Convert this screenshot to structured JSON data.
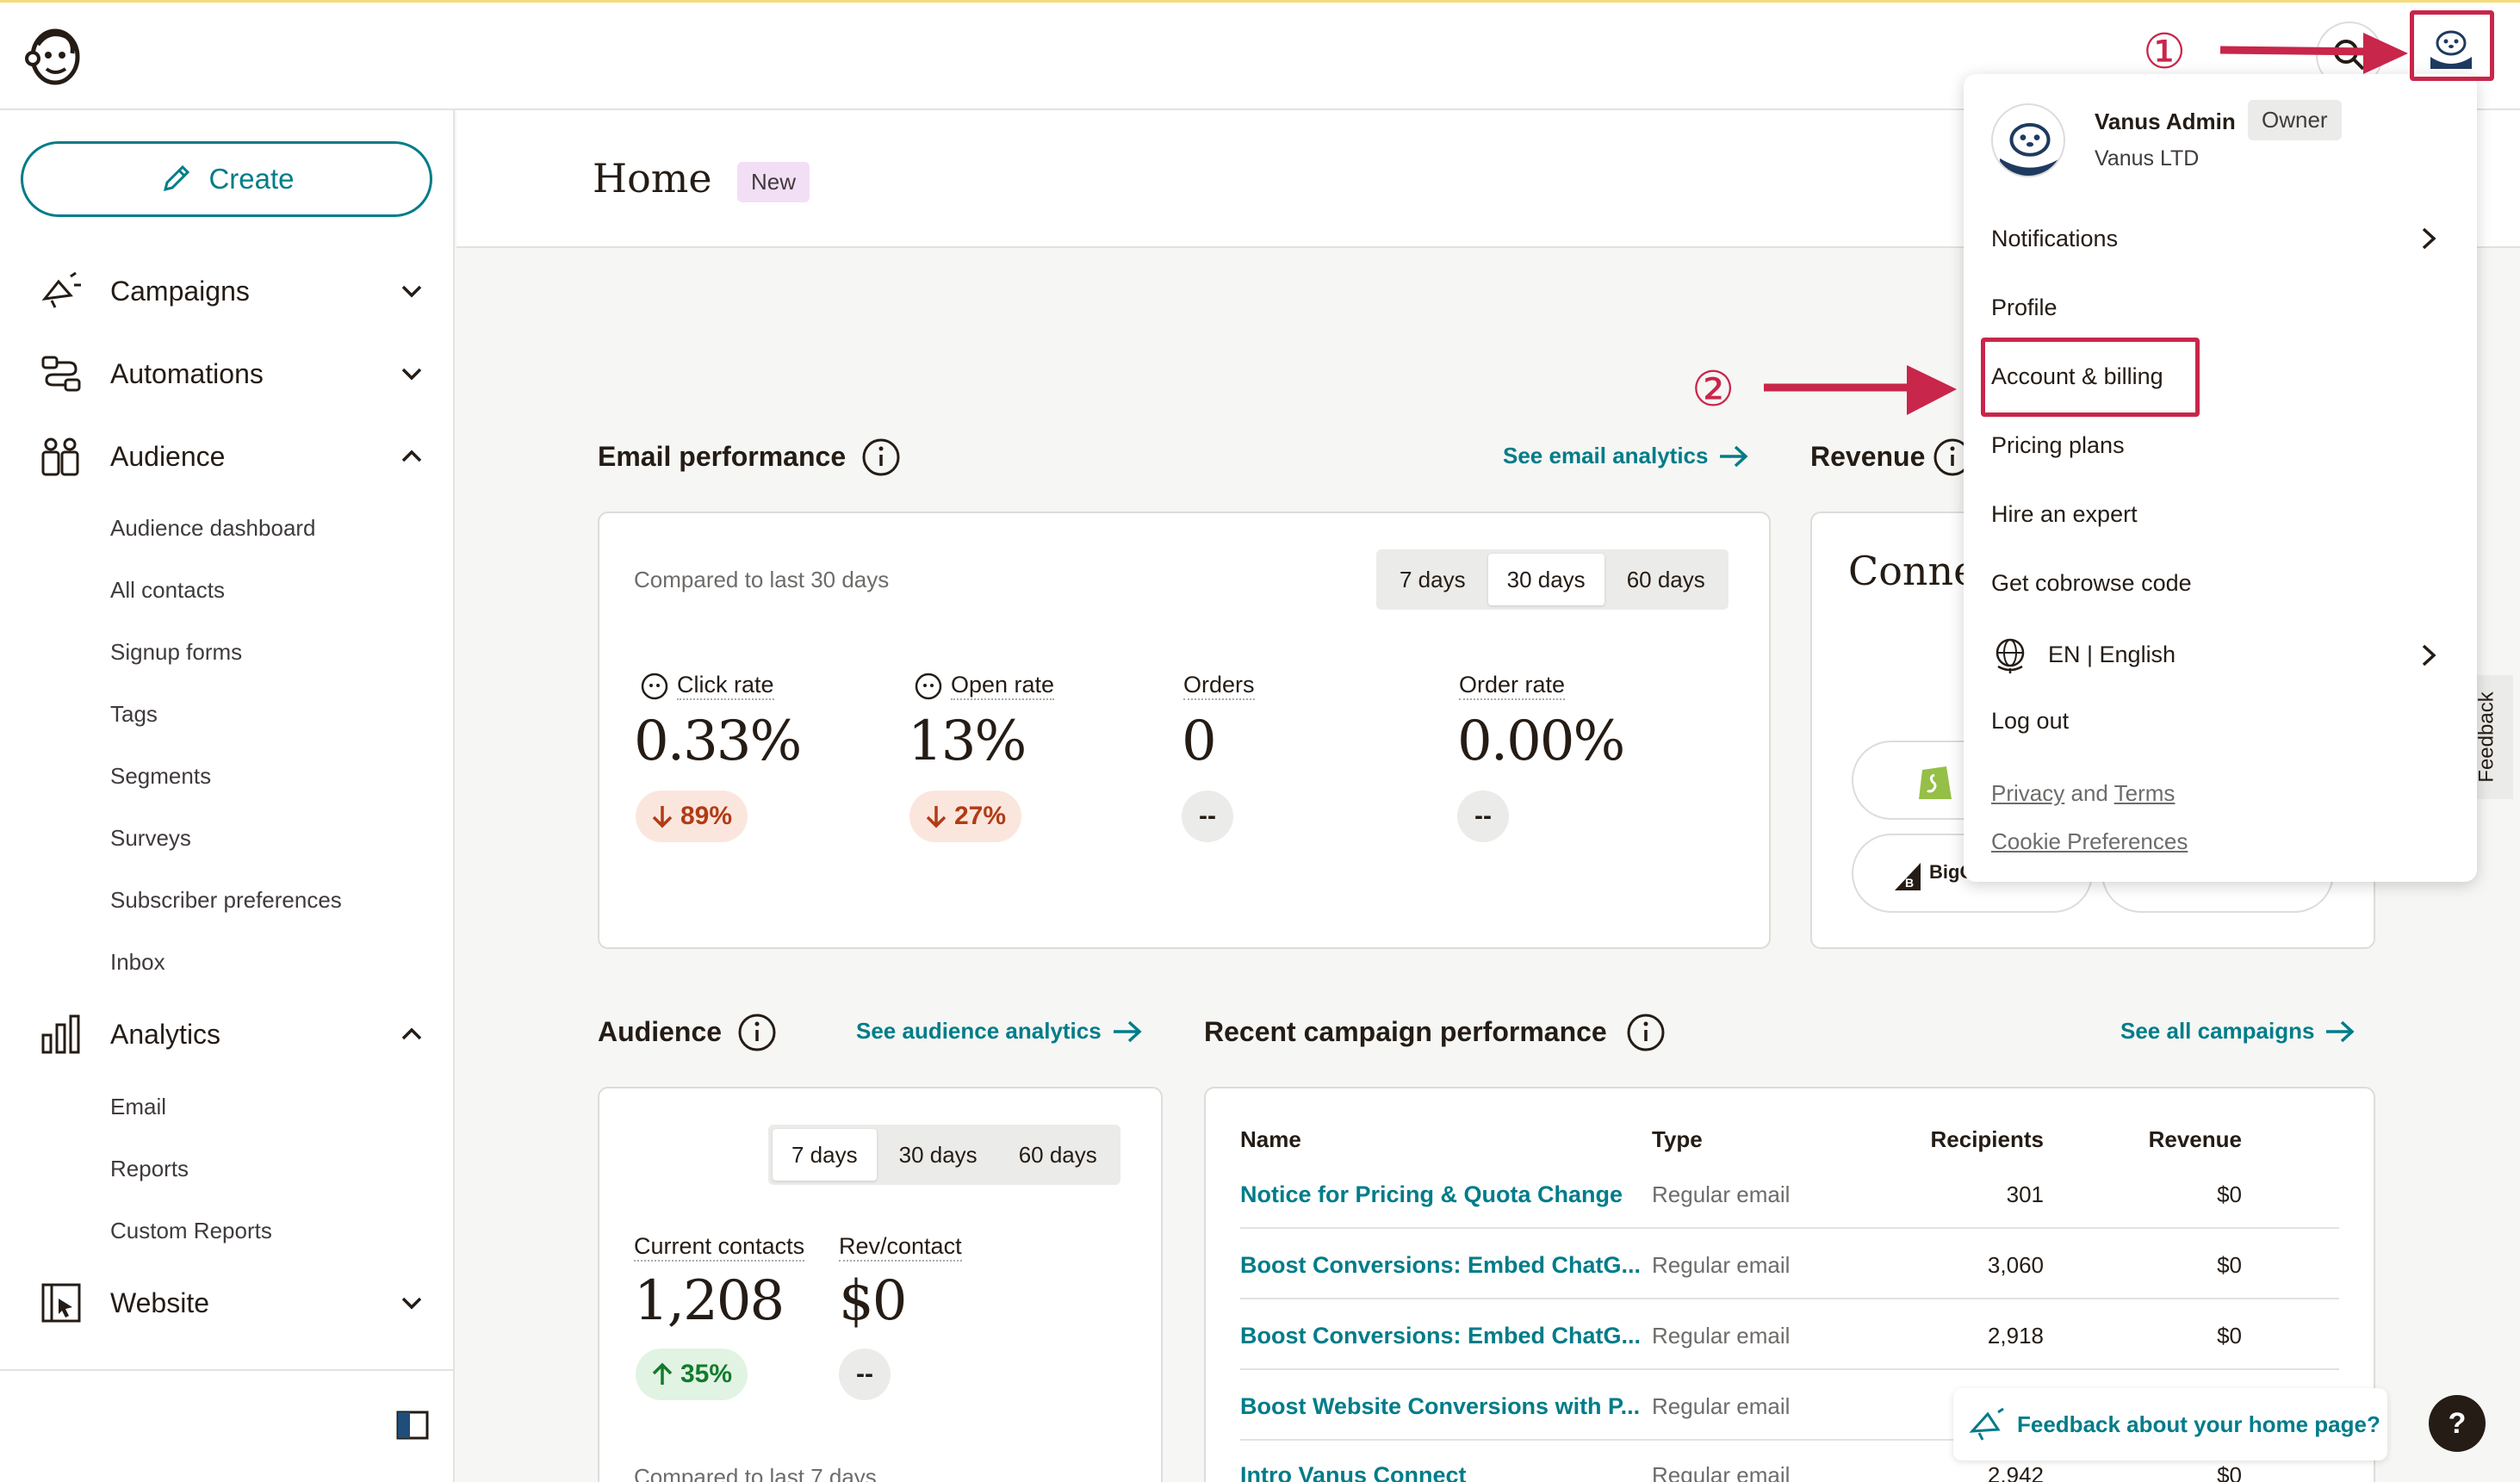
{
  "sidebar": {
    "create_label": "Create",
    "nav": [
      {
        "label": "Campaigns"
      },
      {
        "label": "Automations"
      },
      {
        "label": "Audience"
      },
      {
        "label": "Analytics"
      },
      {
        "label": "Website"
      }
    ],
    "audience_sub": [
      "Audience dashboard",
      "All contacts",
      "Signup forms",
      "Tags",
      "Segments",
      "Surveys",
      "Subscriber preferences",
      "Inbox"
    ],
    "analytics_sub": [
      "Email",
      "Reports",
      "Custom Reports"
    ]
  },
  "header": {
    "title": "Home",
    "badge": "New"
  },
  "email_performance": {
    "title": "Email performance",
    "link": "See email analytics",
    "compared": "Compared to last 30 days",
    "ranges": [
      "7 days",
      "30 days",
      "60 days"
    ],
    "active_range": "30 days",
    "metrics": [
      {
        "label": "Click rate",
        "value": "0.33%",
        "change": "89%",
        "direction": "down"
      },
      {
        "label": "Open rate",
        "value": "13%",
        "change": "27%",
        "direction": "down"
      },
      {
        "label": "Orders",
        "value": "0",
        "change": "--",
        "direction": "none"
      },
      {
        "label": "Order rate",
        "value": "0.00%",
        "change": "--",
        "direction": "none"
      }
    ]
  },
  "revenue": {
    "title": "Revenue",
    "card_heading": "Conne",
    "platform_2": "BigC"
  },
  "audience": {
    "title": "Audience",
    "link": "See audience analytics",
    "ranges": [
      "7 days",
      "30 days",
      "60 days"
    ],
    "active_range": "7 days",
    "current_contacts_label": "Current contacts",
    "current_contacts_value": "1,208",
    "current_contacts_change": "35%",
    "rev_label": "Rev/contact",
    "rev_value": "$0",
    "rev_change": "--",
    "footer": "Compared to last 7 days"
  },
  "campaigns": {
    "title": "Recent campaign performance",
    "link": "See all campaigns",
    "columns": [
      "Name",
      "Type",
      "Recipients",
      "Revenue"
    ],
    "rows": [
      {
        "name": "Notice for Pricing & Quota Change",
        "type": "Regular email",
        "recipients": "301",
        "revenue": "$0"
      },
      {
        "name": "Boost Conversions: Embed ChatG...",
        "type": "Regular email",
        "recipients": "3,060",
        "revenue": "$0"
      },
      {
        "name": "Boost Conversions: Embed ChatG...",
        "type": "Regular email",
        "recipients": "2,918",
        "revenue": "$0"
      },
      {
        "name": "Boost Website Conversions with P...",
        "type": "Regular email",
        "recipients": "",
        "revenue": ""
      },
      {
        "name": "Intro Vanus Connect",
        "type": "Regular email",
        "recipients": "2,942",
        "revenue": "$0"
      }
    ]
  },
  "dropdown": {
    "user_name": "Vanus Admin",
    "role": "Owner",
    "company": "Vanus LTD",
    "items": [
      "Notifications",
      "Profile",
      "Account & billing",
      "Pricing plans",
      "Hire an expert",
      "Get cobrowse code",
      "EN | English",
      "Log out"
    ],
    "privacy": "Privacy",
    "and": "and",
    "terms": "Terms",
    "cookie": "Cookie Preferences"
  },
  "annotations": {
    "step1": "①",
    "step2": "②",
    "color": "#c8264a"
  },
  "feedback": {
    "tab": "Feedback",
    "home": "Feedback about your home page?",
    "help": "?"
  },
  "colors": {
    "brand_teal": "#007c89",
    "text": "#241c15",
    "down": "#b23b14",
    "up": "#137a2c"
  }
}
